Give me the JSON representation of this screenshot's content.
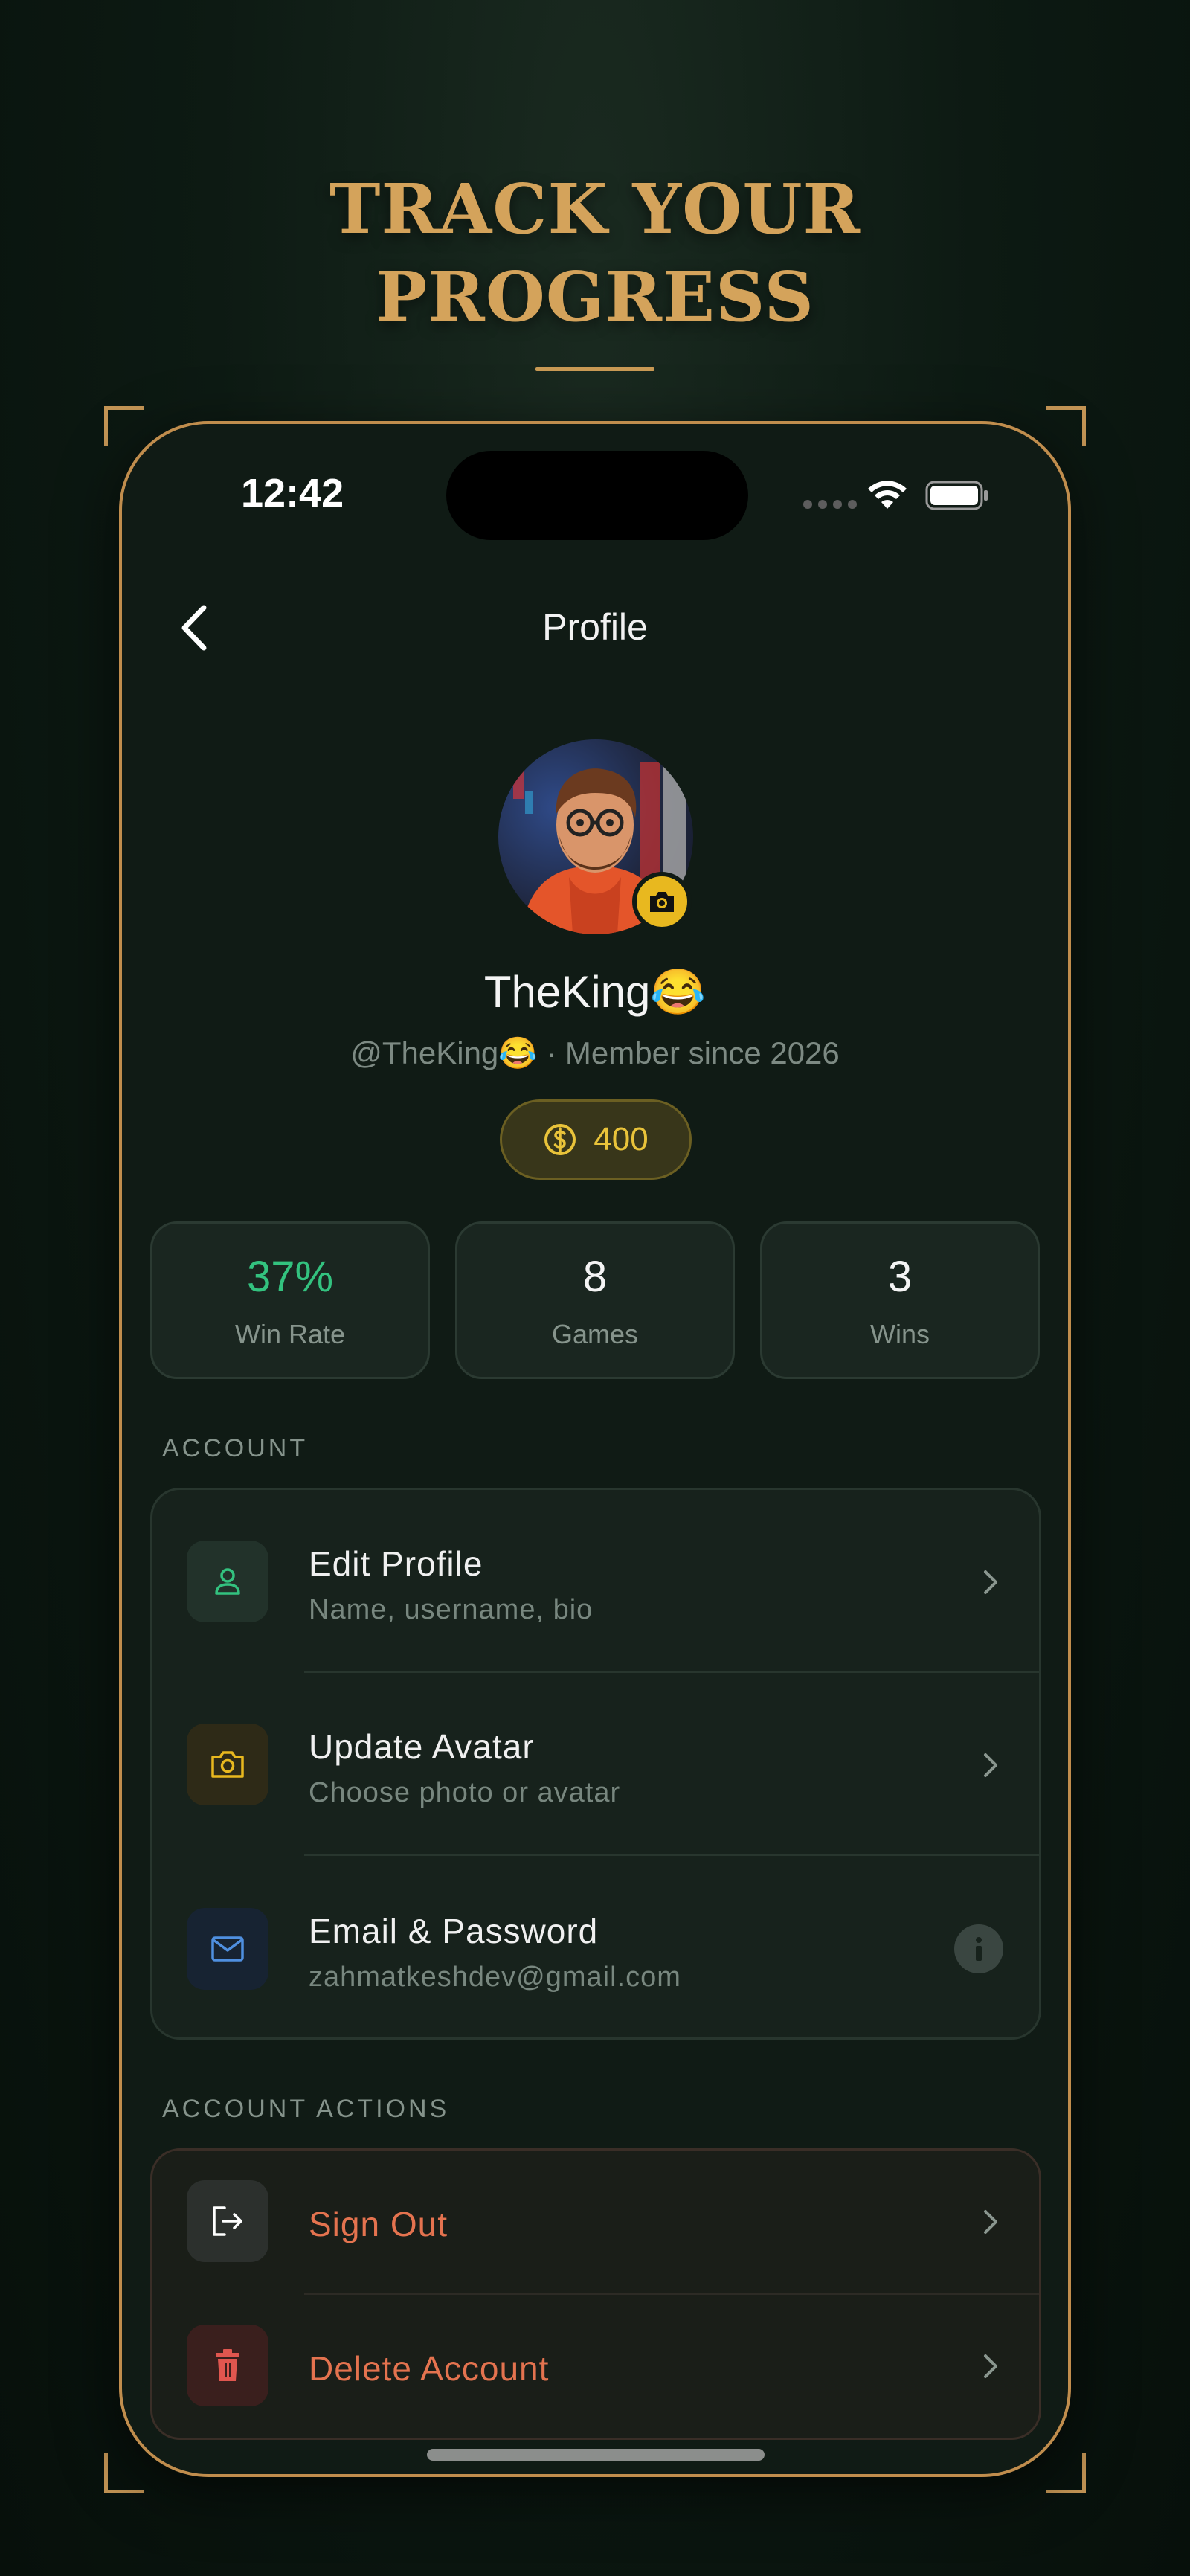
{
  "promo": {
    "headline_line1": "TRACK YOUR",
    "headline_line2": "PROGRESS"
  },
  "status_bar": {
    "time": "12:42"
  },
  "nav": {
    "back_icon": "chevron-left-icon",
    "title": "Profile"
  },
  "profile": {
    "display_name": "TheKing😂",
    "handle": "@TheKing😂",
    "separator": " · ",
    "member_since": "Member since 2026",
    "coins": "400"
  },
  "stats": [
    {
      "value": "37%",
      "label": "Win Rate",
      "color": "#33c27f"
    },
    {
      "value": "8",
      "label": "Games"
    },
    {
      "value": "3",
      "label": "Wins"
    }
  ],
  "account": {
    "section_label": "ACCOUNT",
    "items": [
      {
        "title": "Edit Profile",
        "subtitle": "Name, username, bio",
        "icon": "user-icon",
        "trailing": "chevron-right-icon",
        "icon_color": "#33c27f"
      },
      {
        "title": "Update Avatar",
        "subtitle": "Choose photo or avatar",
        "icon": "camera-icon",
        "trailing": "chevron-right-icon",
        "icon_color": "#e8b81f"
      },
      {
        "title": "Email & Password",
        "subtitle": "zahmatkeshdev@gmail.com",
        "icon": "mail-icon",
        "trailing": "info-icon",
        "icon_color": "#4f8fe0"
      }
    ]
  },
  "account_actions": {
    "section_label": "ACCOUNT ACTIONS",
    "items": [
      {
        "title": "Sign Out",
        "icon": "sign-out-icon",
        "trailing": "chevron-right-icon"
      },
      {
        "title": "Delete Account",
        "icon": "trash-icon",
        "trailing": "chevron-right-icon",
        "icon_color": "#e0564f"
      }
    ]
  },
  "colors": {
    "accent_gold": "#d4a35b",
    "coin_yellow": "#e9c33a",
    "danger_text": "#e4734f"
  }
}
